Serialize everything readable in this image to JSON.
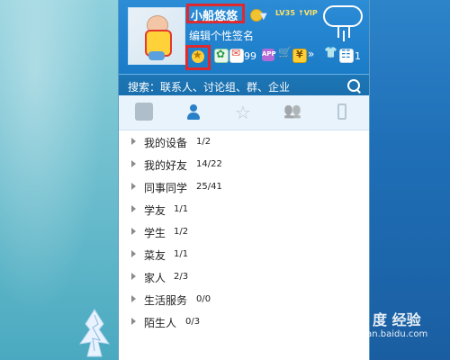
{
  "profile": {
    "nickname": "小船悠悠",
    "level": "LV35",
    "vip": "↑VIP",
    "signature": "编辑个性签名"
  },
  "iconbar": {
    "mail_count": "99",
    "box_count": "1"
  },
  "search": {
    "placeholder": "搜索：联系人、讨论组、群、企业"
  },
  "tabs": [
    {
      "icon": "chat-icon"
    },
    {
      "icon": "contact-icon"
    },
    {
      "icon": "star-icon"
    },
    {
      "icon": "group-icon"
    },
    {
      "icon": "phone-icon"
    }
  ],
  "groups": [
    {
      "name": "我的设备",
      "count": "1/2"
    },
    {
      "name": "我的好友",
      "count": "14/22"
    },
    {
      "name": "同事同学",
      "count": "25/41"
    },
    {
      "name": "学友",
      "count": "1/1"
    },
    {
      "name": "学生",
      "count": "1/2"
    },
    {
      "name": "菜友",
      "count": "1/1"
    },
    {
      "name": "家人",
      "count": "2/3"
    },
    {
      "name": "生活服务",
      "count": "0/0"
    },
    {
      "name": "陌生人",
      "count": "0/3"
    }
  ],
  "watermark": {
    "main": "Bai 度 经验",
    "sub": "jingyan.baidu.com"
  },
  "colors": {
    "panel_header": "#1a7bc7",
    "highlight_box": "#e0282d",
    "search_bar": "#1a6fae"
  }
}
